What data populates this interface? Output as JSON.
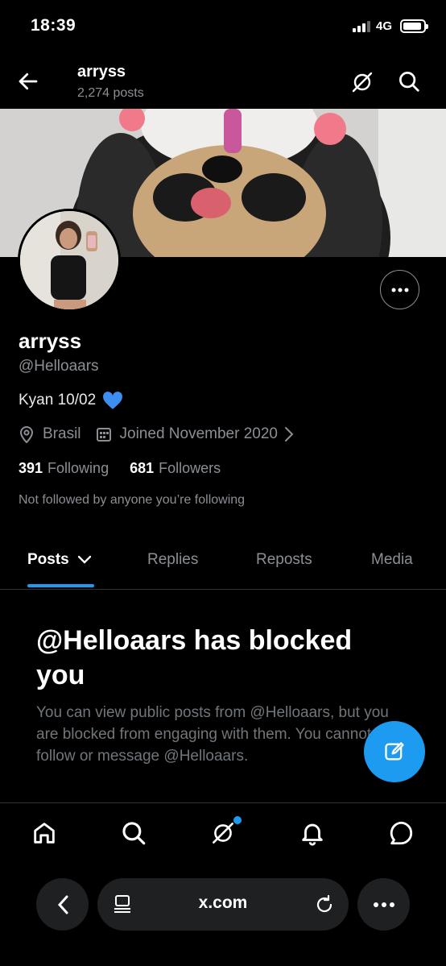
{
  "status_bar": {
    "time": "18:39",
    "network": "4G"
  },
  "header": {
    "name": "arryss",
    "post_count": "2,274 posts"
  },
  "profile": {
    "display_name": "arryss",
    "handle": "@Helloaars",
    "bio": "Kyan 10/02",
    "location": "Brasil",
    "joined": "Joined November 2020",
    "following_count": "391",
    "following_label": "Following",
    "followers_count": "681",
    "followers_label": "Followers",
    "not_followed_text": "Not followed by anyone you’re following"
  },
  "tabs": [
    {
      "label": "Posts"
    },
    {
      "label": "Replies"
    },
    {
      "label": "Reposts"
    },
    {
      "label": "Media"
    }
  ],
  "blocked": {
    "title": "@Helloaars has blocked you",
    "message": "You can view public posts from @Helloaars, but you are blocked from engaging with them. You cannot follow or message @Helloaars."
  },
  "browser": {
    "url": "x.com"
  },
  "colors": {
    "accent": "#1d9bf0",
    "background": "#000000",
    "muted": "#8b8f94"
  },
  "icons": [
    "back-arrow-icon",
    "grok-icon",
    "search-icon",
    "more-icon",
    "blue-heart-icon",
    "location-icon",
    "calendar-icon",
    "chevron-right-icon",
    "chevron-down-icon",
    "compose-icon",
    "home-icon",
    "notifications-icon",
    "messages-icon",
    "reader-icon",
    "reload-icon"
  ]
}
